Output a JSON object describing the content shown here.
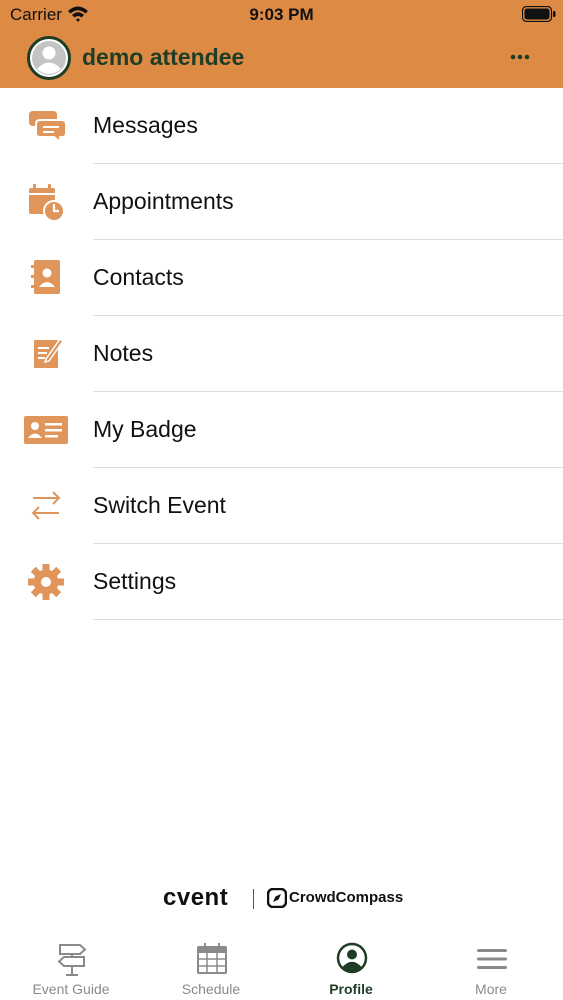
{
  "status_bar": {
    "carrier": "Carrier",
    "time": "9:03 PM"
  },
  "header": {
    "user_name": "demo attendee",
    "background_color": "#dd8a45",
    "title_color": "#1f3d26"
  },
  "menu": {
    "icon_color": "#e0955a",
    "items": [
      {
        "label": "Messages",
        "icon": "chat-bubbles-icon"
      },
      {
        "label": "Appointments",
        "icon": "calendar-clock-icon"
      },
      {
        "label": "Contacts",
        "icon": "address-book-icon"
      },
      {
        "label": "Notes",
        "icon": "note-pencil-icon"
      },
      {
        "label": "My Badge",
        "icon": "id-badge-icon"
      },
      {
        "label": "Switch Event",
        "icon": "switch-arrows-icon"
      },
      {
        "label": "Settings",
        "icon": "gear-icon"
      }
    ]
  },
  "branding": {
    "left": "cvent",
    "right": "CrowdCompass"
  },
  "tabs": [
    {
      "label": "Event Guide",
      "icon": "signpost-icon",
      "active": false
    },
    {
      "label": "Schedule",
      "icon": "calendar-grid-icon",
      "active": false
    },
    {
      "label": "Profile",
      "icon": "profile-icon",
      "active": true
    },
    {
      "label": "More",
      "icon": "hamburger-menu-icon",
      "active": false
    }
  ]
}
